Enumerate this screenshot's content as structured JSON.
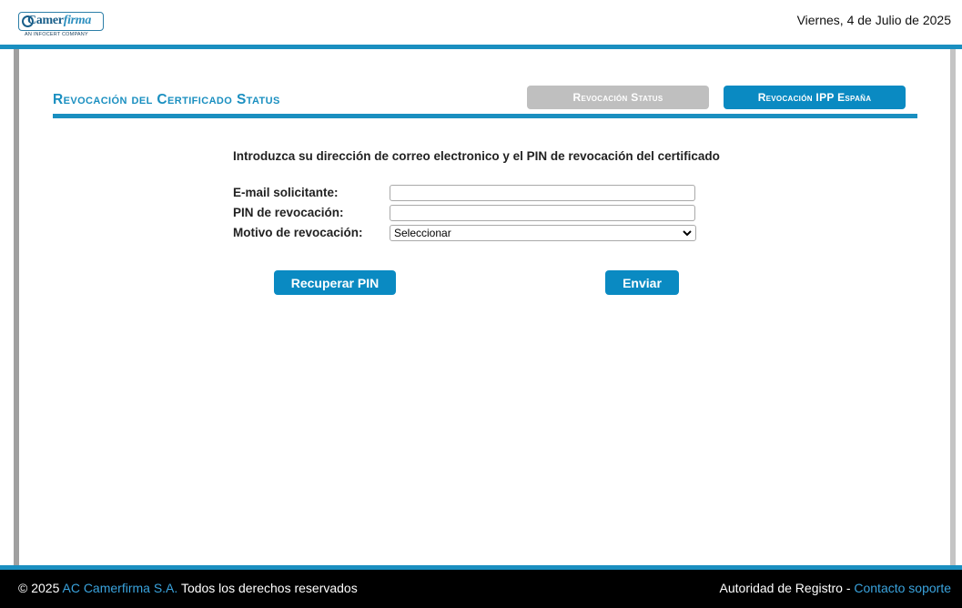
{
  "header": {
    "logo_text_a": "Camer",
    "logo_text_b": "firma",
    "logo_tagline": "AN INFOCERT COMPANY",
    "date": "Viernes, 4 de Julio de 2025"
  },
  "main": {
    "title": "Revocación del Certificado Status",
    "tabs": {
      "status": "Revocación Status",
      "ipp": "Revocación IPP España"
    },
    "intro": "Introduzca su dirección de correo electronico y el PIN de revocación del certificado",
    "form": {
      "email_label": "E-mail solicitante:",
      "email_value": "",
      "pin_label": "PIN de revocación:",
      "pin_value": "",
      "reason_label": "Motivo de revocación:",
      "reason_selected": "Seleccionar"
    },
    "buttons": {
      "recover": "Recuperar PIN",
      "send": "Enviar"
    }
  },
  "footer": {
    "copyright": "© 2025",
    "company_link": "AC Camerfirma S.A.",
    "rights": "Todos los derechos reservados",
    "registry": "Autoridad de Registro -",
    "support_link": "Contacto soporte"
  },
  "colors": {
    "accent": "#1a8fc0",
    "button": "#0a8ac2",
    "disabled_tab": "#bfbfbf",
    "footer_bg": "#000000",
    "footer_link": "#3aa3dd"
  }
}
